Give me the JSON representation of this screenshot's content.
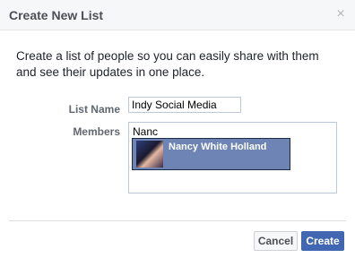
{
  "dialog": {
    "title": "Create New List",
    "close_icon": "close-icon",
    "description": "Create a list of people so you can easily share with them and see their updates in one place."
  },
  "form": {
    "list_name_label": "List Name",
    "list_name_value": "Indy Social Media",
    "members_label": "Members",
    "members_query": "Nanc",
    "suggestion": {
      "name": "Nancy White Holland"
    }
  },
  "footer": {
    "cancel_label": "Cancel",
    "create_label": "Create"
  },
  "colors": {
    "primary": "#4267b2",
    "suggestion_highlight": "#6d84b4"
  }
}
